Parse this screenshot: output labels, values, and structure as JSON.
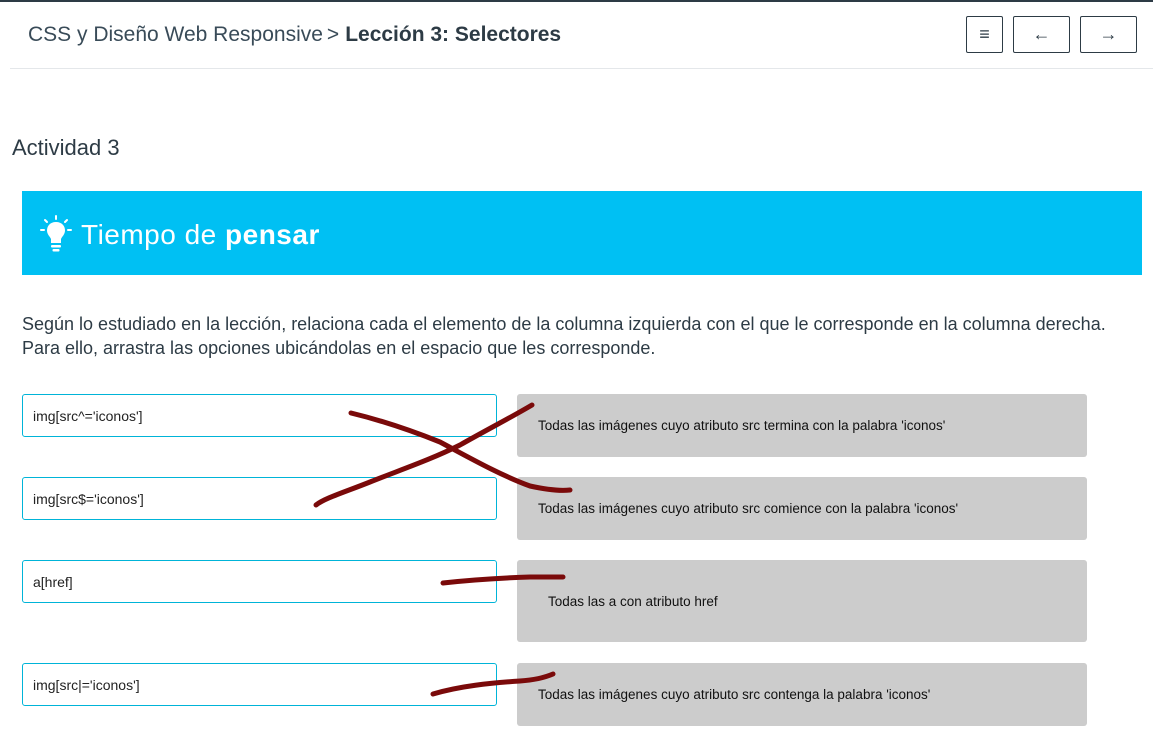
{
  "header": {
    "course": "CSS y Diseño Web Responsive",
    "separator": ">",
    "current": "Lección 3: Selectores",
    "menu_icon": "≡",
    "prev_icon": "←",
    "next_icon": "→"
  },
  "activity_title": "Actividad 3",
  "banner": {
    "title_light": "Tiempo de",
    "title_bold": "pensar",
    "icon": "lightbulb-icon",
    "color": "#00c0f3"
  },
  "instructions": "Según lo estudiado en la lección, relaciona cada el elemento de la columna izquierda con el que le corresponde en la columna derecha. Para ello, arrastra las opciones ubicándolas en el espacio que les corresponde.",
  "left_items": [
    "img[src^='iconos']",
    "img[src$='iconos']",
    "a[href]",
    "img[src|='iconos']"
  ],
  "right_items": [
    "Todas las imágenes cuyo atributo src termina con la palabra 'iconos'",
    "Todas las imágenes cuyo atributo src comience con la palabra 'iconos'",
    "Todas las a con atributo href",
    "Todas las imágenes cuyo atributo src contenga la palabra 'iconos'"
  ],
  "colors": {
    "accent": "#00c0f3",
    "input_border": "#00b4d8",
    "drop_zone": "#cccccc",
    "annotation": "#7a0a0a"
  }
}
